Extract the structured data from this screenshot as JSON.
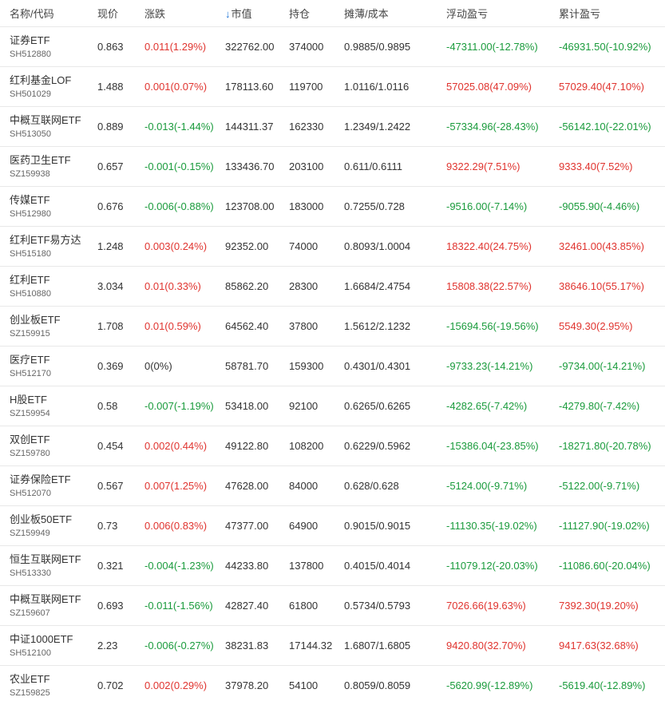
{
  "headers": {
    "name": "名称/代码",
    "price": "现价",
    "change": "涨跌",
    "market_value": "市值",
    "holding": "持仓",
    "cost": "摊薄/成本",
    "float_pl": "浮动盈亏",
    "total_pl": "累计盈亏"
  },
  "colors": {
    "up": "#e0342f",
    "down": "#1a9b3c",
    "sort_arrow": "#1e73d6"
  },
  "rows": [
    {
      "name": "证券ETF",
      "code": "SH512880",
      "price": "0.863",
      "change": "0.011(1.29%)",
      "change_dir": "up",
      "mv": "322762.00",
      "hold": "374000",
      "cost": "0.9885/0.9895",
      "float": "-47311.00(-12.78%)",
      "float_dir": "down",
      "total": "-46931.50(-10.92%)",
      "total_dir": "down"
    },
    {
      "name": "红利基金LOF",
      "code": "SH501029",
      "price": "1.488",
      "change": "0.001(0.07%)",
      "change_dir": "up",
      "mv": "178113.60",
      "hold": "119700",
      "cost": "1.0116/1.0116",
      "float": "57025.08(47.09%)",
      "float_dir": "up",
      "total": "57029.40(47.10%)",
      "total_dir": "up"
    },
    {
      "name": "中概互联网ETF",
      "code": "SH513050",
      "price": "0.889",
      "change": "-0.013(-1.44%)",
      "change_dir": "down",
      "mv": "144311.37",
      "hold": "162330",
      "cost": "1.2349/1.2422",
      "float": "-57334.96(-28.43%)",
      "float_dir": "down",
      "total": "-56142.10(-22.01%)",
      "total_dir": "down"
    },
    {
      "name": "医药卫生ETF",
      "code": "SZ159938",
      "price": "0.657",
      "change": "-0.001(-0.15%)",
      "change_dir": "down",
      "mv": "133436.70",
      "hold": "203100",
      "cost": "0.611/0.6111",
      "float": "9322.29(7.51%)",
      "float_dir": "up",
      "total": "9333.40(7.52%)",
      "total_dir": "up"
    },
    {
      "name": "传媒ETF",
      "code": "SH512980",
      "price": "0.676",
      "change": "-0.006(-0.88%)",
      "change_dir": "down",
      "mv": "123708.00",
      "hold": "183000",
      "cost": "0.7255/0.728",
      "float": "-9516.00(-7.14%)",
      "float_dir": "down",
      "total": "-9055.90(-4.46%)",
      "total_dir": "down"
    },
    {
      "name": "红利ETF易方达",
      "code": "SH515180",
      "price": "1.248",
      "change": "0.003(0.24%)",
      "change_dir": "up",
      "mv": "92352.00",
      "hold": "74000",
      "cost": "0.8093/1.0004",
      "float": "18322.40(24.75%)",
      "float_dir": "up",
      "total": "32461.00(43.85%)",
      "total_dir": "up"
    },
    {
      "name": "红利ETF",
      "code": "SH510880",
      "price": "3.034",
      "change": "0.01(0.33%)",
      "change_dir": "up",
      "mv": "85862.20",
      "hold": "28300",
      "cost": "1.6684/2.4754",
      "float": "15808.38(22.57%)",
      "float_dir": "up",
      "total": "38646.10(55.17%)",
      "total_dir": "up"
    },
    {
      "name": "创业板ETF",
      "code": "SZ159915",
      "price": "1.708",
      "change": "0.01(0.59%)",
      "change_dir": "up",
      "mv": "64562.40",
      "hold": "37800",
      "cost": "1.5612/2.1232",
      "float": "-15694.56(-19.56%)",
      "float_dir": "down",
      "total": "5549.30(2.95%)",
      "total_dir": "up"
    },
    {
      "name": "医疗ETF",
      "code": "SH512170",
      "price": "0.369",
      "change": "0(0%)",
      "change_dir": "flat",
      "mv": "58781.70",
      "hold": "159300",
      "cost": "0.4301/0.4301",
      "float": "-9733.23(-14.21%)",
      "float_dir": "down",
      "total": "-9734.00(-14.21%)",
      "total_dir": "down"
    },
    {
      "name": "H股ETF",
      "code": "SZ159954",
      "price": "0.58",
      "change": "-0.007(-1.19%)",
      "change_dir": "down",
      "mv": "53418.00",
      "hold": "92100",
      "cost": "0.6265/0.6265",
      "float": "-4282.65(-7.42%)",
      "float_dir": "down",
      "total": "-4279.80(-7.42%)",
      "total_dir": "down"
    },
    {
      "name": "双创ETF",
      "code": "SZ159780",
      "price": "0.454",
      "change": "0.002(0.44%)",
      "change_dir": "up",
      "mv": "49122.80",
      "hold": "108200",
      "cost": "0.6229/0.5962",
      "float": "-15386.04(-23.85%)",
      "float_dir": "down",
      "total": "-18271.80(-20.78%)",
      "total_dir": "down"
    },
    {
      "name": "证券保险ETF",
      "code": "SH512070",
      "price": "0.567",
      "change": "0.007(1.25%)",
      "change_dir": "up",
      "mv": "47628.00",
      "hold": "84000",
      "cost": "0.628/0.628",
      "float": "-5124.00(-9.71%)",
      "float_dir": "down",
      "total": "-5122.00(-9.71%)",
      "total_dir": "down"
    },
    {
      "name": "创业板50ETF",
      "code": "SZ159949",
      "price": "0.73",
      "change": "0.006(0.83%)",
      "change_dir": "up",
      "mv": "47377.00",
      "hold": "64900",
      "cost": "0.9015/0.9015",
      "float": "-11130.35(-19.02%)",
      "float_dir": "down",
      "total": "-11127.90(-19.02%)",
      "total_dir": "down"
    },
    {
      "name": "恒生互联网ETF",
      "code": "SH513330",
      "price": "0.321",
      "change": "-0.004(-1.23%)",
      "change_dir": "down",
      "mv": "44233.80",
      "hold": "137800",
      "cost": "0.4015/0.4014",
      "float": "-11079.12(-20.03%)",
      "float_dir": "down",
      "total": "-11086.60(-20.04%)",
      "total_dir": "down"
    },
    {
      "name": "中概互联网ETF",
      "code": "SZ159607",
      "price": "0.693",
      "change": "-0.011(-1.56%)",
      "change_dir": "down",
      "mv": "42827.40",
      "hold": "61800",
      "cost": "0.5734/0.5793",
      "float": "7026.66(19.63%)",
      "float_dir": "up",
      "total": "7392.30(19.20%)",
      "total_dir": "up"
    },
    {
      "name": "中证1000ETF",
      "code": "SH512100",
      "price": "2.23",
      "change": "-0.006(-0.27%)",
      "change_dir": "down",
      "mv": "38231.83",
      "hold": "17144.32",
      "cost": "1.6807/1.6805",
      "float": "9420.80(32.70%)",
      "float_dir": "up",
      "total": "9417.63(32.68%)",
      "total_dir": "up"
    },
    {
      "name": "农业ETF",
      "code": "SZ159825",
      "price": "0.702",
      "change": "0.002(0.29%)",
      "change_dir": "up",
      "mv": "37978.20",
      "hold": "54100",
      "cost": "0.8059/0.8059",
      "float": "-5620.99(-12.89%)",
      "float_dir": "down",
      "total": "-5619.40(-12.89%)",
      "total_dir": "down"
    }
  ]
}
